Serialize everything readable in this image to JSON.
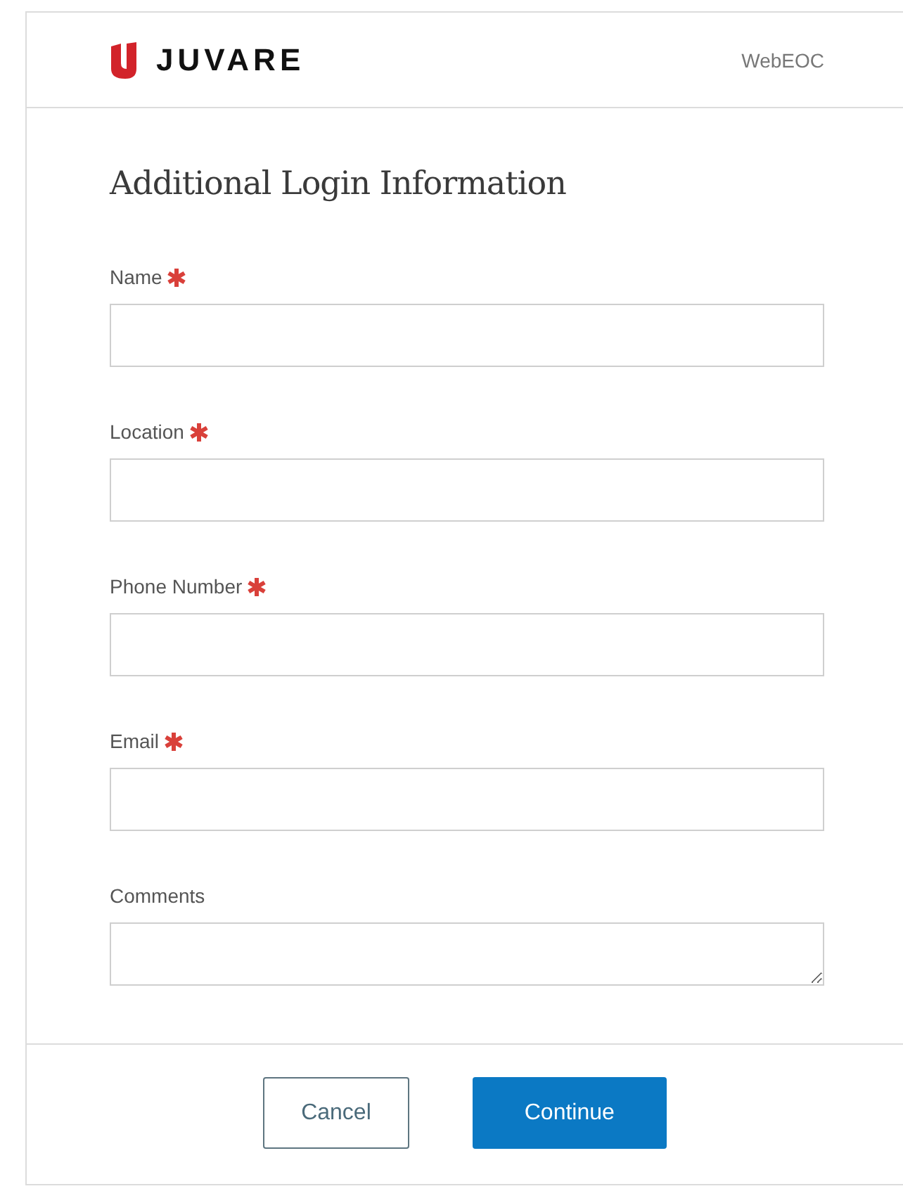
{
  "header": {
    "brand": "JUVARE",
    "product": "WebEOC"
  },
  "title": "Additional Login Information",
  "fields": [
    {
      "label": "Name",
      "required": true,
      "kind": "input"
    },
    {
      "label": "Location",
      "required": true,
      "kind": "input"
    },
    {
      "label": "Phone Number",
      "required": true,
      "kind": "input"
    },
    {
      "label": "Email",
      "required": true,
      "kind": "input"
    },
    {
      "label": "Comments",
      "required": false,
      "kind": "textarea"
    }
  ],
  "buttons": [
    {
      "label": "Cancel",
      "kind": "secondary"
    },
    {
      "label": "Continue",
      "kind": "primary"
    }
  ]
}
